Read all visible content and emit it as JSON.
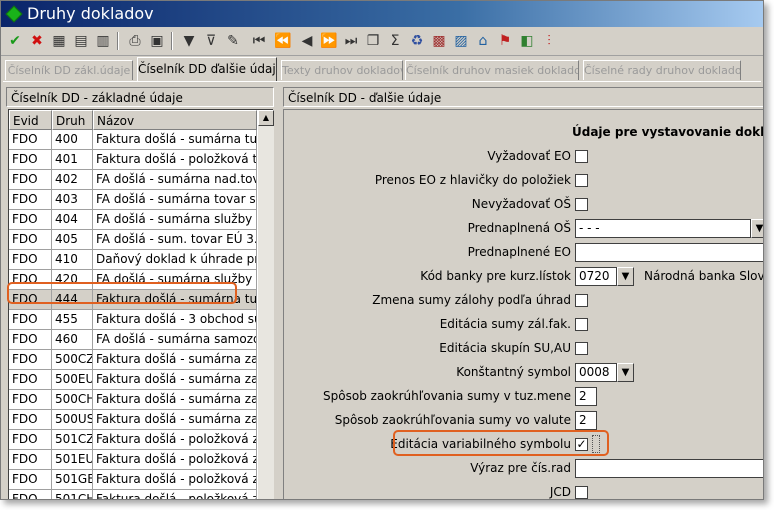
{
  "window": {
    "title": "Druhy dokladov"
  },
  "toolbar": {
    "icons": [
      "check-icon",
      "cross-icon",
      "grid-icon",
      "grid-add-icon",
      "grid-delete-icon",
      "print-icon",
      "preview-icon",
      "filter-icon",
      "filter-clear-icon",
      "filter-edit-icon",
      "first-icon",
      "prev-page-icon",
      "prev-icon",
      "next-icon",
      "last-page-icon",
      "copy-icon",
      "sum-icon",
      "trash-icon",
      "calendar-icon",
      "chart-icon",
      "home-icon",
      "flag-icon",
      "export-icon",
      "settings-icon"
    ]
  },
  "tabs": [
    {
      "label": "Číselník DD zákl.údaje",
      "active": false
    },
    {
      "label": "Číselník DD ďalšie údaje",
      "active": true
    },
    {
      "label": "Texty druhov dokladov",
      "active": false
    },
    {
      "label": "Číselník druhov masiek dokladov",
      "active": false
    },
    {
      "label": "Číselné rady druhov dokladov",
      "active": false
    }
  ],
  "left_panel": {
    "title": "Číselník DD - základné údaje",
    "columns": [
      "Evid",
      "Druh",
      "Názov"
    ],
    "rows": [
      [
        "FDO",
        "400",
        "Faktura došlá - sumárna  tuz"
      ],
      [
        "FDO",
        "401",
        "Faktura došlá - položková  tuz"
      ],
      [
        "FDO",
        "402",
        "FA došlá - sumárna nad.tova"
      ],
      [
        "FDO",
        "403",
        "FA došlá - sumárna tovar s m"
      ],
      [
        "FDO",
        "404",
        "FA došlá - sumárna služby z l"
      ],
      [
        "FDO",
        "405",
        "FA došlá - sum. tovar EÚ 3.st"
      ],
      [
        "FDO",
        "410",
        "Daňový doklad k úhrade pred"
      ],
      [
        "FDO",
        "420",
        "FA došlá - sumárna služby z l"
      ],
      [
        "FDO",
        "444",
        "Faktura došlá - sumárna  tuz"
      ],
      [
        "FDO",
        "455",
        "Faktura došlá - 3 obchod sur"
      ],
      [
        "FDO",
        "460",
        "FA došlá - sumárna samozda"
      ],
      [
        "FDO",
        "500CZ",
        "Faktura došlá - sumárna zah"
      ],
      [
        "FDO",
        "500EU",
        "Faktura došlá - sumárna zah"
      ],
      [
        "FDO",
        "500CH",
        "Faktura došlá - sumárna zah"
      ],
      [
        "FDO",
        "500US",
        "Faktura došlá - sumárna zah"
      ],
      [
        "FDO",
        "501CZ",
        "Faktura došlá - položková zah"
      ],
      [
        "FDO",
        "501EU",
        "Faktura došlá - položková zah"
      ],
      [
        "FDO",
        "501GB",
        "Faktura došlá - položková zah"
      ],
      [
        "FDO",
        "501CH",
        "Faktura došlá - položková zah"
      ]
    ],
    "selected_row": 8
  },
  "right_panel": {
    "title": "Číselník DD - ďalšie údaje",
    "section_title": "Údaje pre vystavovanie dokladu",
    "fields": {
      "vyzadovat_eo": {
        "label": "Vyžadovať EO",
        "checked": false
      },
      "prenos_eo": {
        "label": "Prenos EO z hlavičky do položiek",
        "checked": false
      },
      "nevyzadovat_os": {
        "label": "Nevyžadovať OŠ",
        "checked": false
      },
      "prednaplnena_os": {
        "label": "Prednaplnená OŠ",
        "value": " -   -   -"
      },
      "prednaplnene_eo": {
        "label": "Prednaplnené EO",
        "value": ""
      },
      "kod_banky": {
        "label": "Kód banky pre kurz.lístok",
        "value": "0720",
        "note": "Národná banka Slove"
      },
      "zmena_sumy": {
        "label": "Zmena sumy zálohy podľa úhrad",
        "checked": false
      },
      "editacia_sumy": {
        "label": "Editácia sumy zál.fak.",
        "checked": false
      },
      "editacia_skupin": {
        "label": "Editácia skupín SU,AU",
        "checked": false
      },
      "konst_symbol": {
        "label": "Konštantný symbol",
        "value": "0008"
      },
      "zaokr_tuz": {
        "label": "Spôsob zaokrúhľovania sumy v tuz.mene",
        "value": "2"
      },
      "zaokr_valuta": {
        "label": "Spôsob zaokrúhľovania sumy vo valute",
        "value": "2"
      },
      "editacia_vs": {
        "label": "Editácia variabilného symbolu",
        "checked": true
      },
      "vyraz": {
        "label": "Výraz pre čís.rad",
        "value": ""
      },
      "jcd": {
        "label": "JCD",
        "checked": false
      }
    }
  },
  "colors": {
    "highlight": "#e06020",
    "title_bar": "#0a246a"
  }
}
